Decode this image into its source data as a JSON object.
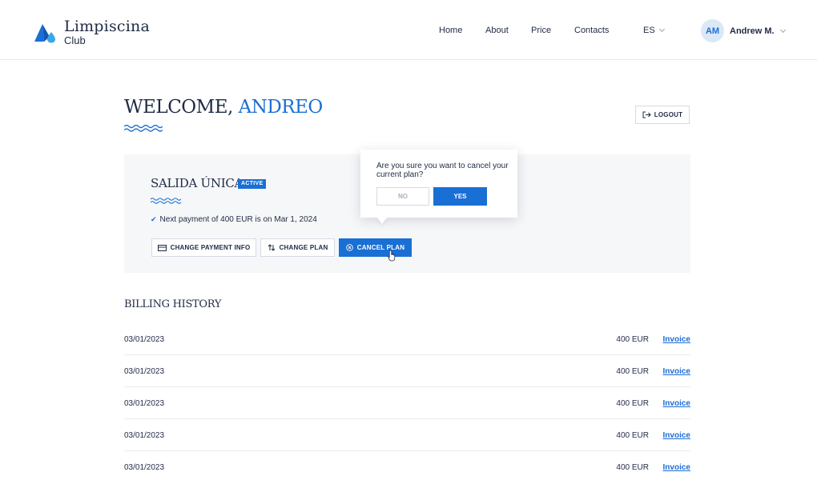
{
  "brand": {
    "name_line1": "Limpiscina",
    "name_line2": "Club"
  },
  "nav": {
    "items": [
      "Home",
      "About",
      "Price",
      "Contacts"
    ],
    "language": "ES"
  },
  "user": {
    "initials": "AM",
    "name": "Andrew M."
  },
  "welcome": {
    "prefix": "WELCOME,",
    "name": "ANDREO"
  },
  "logout_label": "LOGOUT",
  "plan": {
    "title": "SALIDA ÚNICA",
    "status": "ACTIVE",
    "payment_text": "Next payment of 400 EUR is on Mar 1, 2024",
    "buttons": {
      "change_payment": "CHANGE PAYMENT INFO",
      "change_plan": "CHANGE PLAN",
      "cancel_plan": "CANCEL PLAN"
    }
  },
  "confirm": {
    "question": "Are you sure you want to cancel your current plan?",
    "no": "NO",
    "yes": "YES"
  },
  "billing": {
    "title": "BILLING HISTORY",
    "rows": [
      {
        "date": "03/01/2023",
        "amount": "400 EUR",
        "link": "Invoice"
      },
      {
        "date": "03/01/2023",
        "amount": "400 EUR",
        "link": "Invoice"
      },
      {
        "date": "03/01/2023",
        "amount": "400 EUR",
        "link": "Invoice"
      },
      {
        "date": "03/01/2023",
        "amount": "400 EUR",
        "link": "Invoice"
      },
      {
        "date": "03/01/2023",
        "amount": "400 EUR",
        "link": "Invoice"
      }
    ]
  },
  "colors": {
    "accent": "#1a6fd4",
    "text": "#1f2a44",
    "card_bg": "#f6f7f9"
  }
}
